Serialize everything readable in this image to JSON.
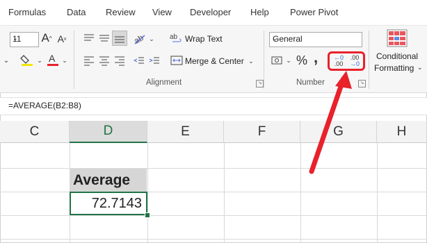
{
  "tabs": [
    "Formulas",
    "Data",
    "Review",
    "View",
    "Developer",
    "Help",
    "Power Pivot"
  ],
  "font": {
    "size": "11"
  },
  "alignment": {
    "wrap_text": "Wrap Text",
    "merge_center": "Merge & Center",
    "label": "Alignment"
  },
  "number": {
    "format": "General",
    "label": "Number",
    "percent": "%",
    "comma": ",",
    "increase_decimal_top": "←0",
    "increase_decimal_bottom": ".00",
    "decrease_decimal_top": ".00",
    "decrease_decimal_bottom": "→0"
  },
  "styles": {
    "conditional_line1": "Conditional",
    "conditional_line2": "Formatting"
  },
  "formula": "=AVERAGE(B2:B8)",
  "columns": [
    "C",
    "D",
    "E",
    "F",
    "G",
    "H"
  ],
  "cells": {
    "header": "Average",
    "value": "72.7143"
  },
  "colors": {
    "highlight": "#e8212b",
    "excel_green": "#217346"
  }
}
